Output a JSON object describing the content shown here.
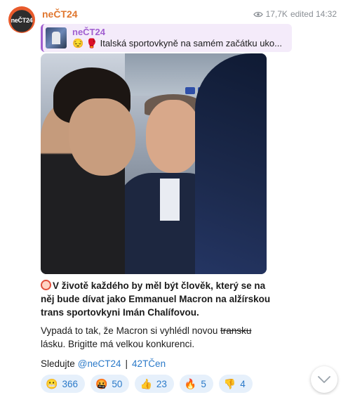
{
  "channel": {
    "name": "neČT24",
    "avatar_text": "neČT24",
    "views": "17,7K",
    "edited": "edited 14:32"
  },
  "reply": {
    "author": "neČT24",
    "snippet": "😔 🥊 Italská sportovkyně na samém začátku uko..."
  },
  "message": {
    "bold_text": "V životě každého by měl být člověk, který se na něj bude dívat jako Emmanuel Macron na alžírskou trans sportovkyni Imán Chalífovou.",
    "normal_pre": "Vypadá to tak, že Macron si vyhlédl novou ",
    "normal_strike": "transku",
    "normal_post": " lásku. Brigitte má velkou konkurenci."
  },
  "follow": {
    "label": "Sledujte",
    "channel_link": "@neCT24",
    "separator": "|",
    "second_link": "42TČen"
  },
  "reactions": [
    {
      "icon": "😬",
      "count": "366"
    },
    {
      "icon": "🤬",
      "count": "50"
    },
    {
      "icon": "👍",
      "count": "23"
    },
    {
      "icon": "🔥",
      "count": "5"
    },
    {
      "icon": "👎",
      "count": "4"
    }
  ],
  "icons": {
    "eye": "eye-icon",
    "scroll": "chevron-down-icon"
  },
  "colors": {
    "channel_name": "#e0772f",
    "reply_accent": "#a15fd0",
    "link": "#2b7ac9",
    "reaction_bg": "#e6f0fb"
  }
}
